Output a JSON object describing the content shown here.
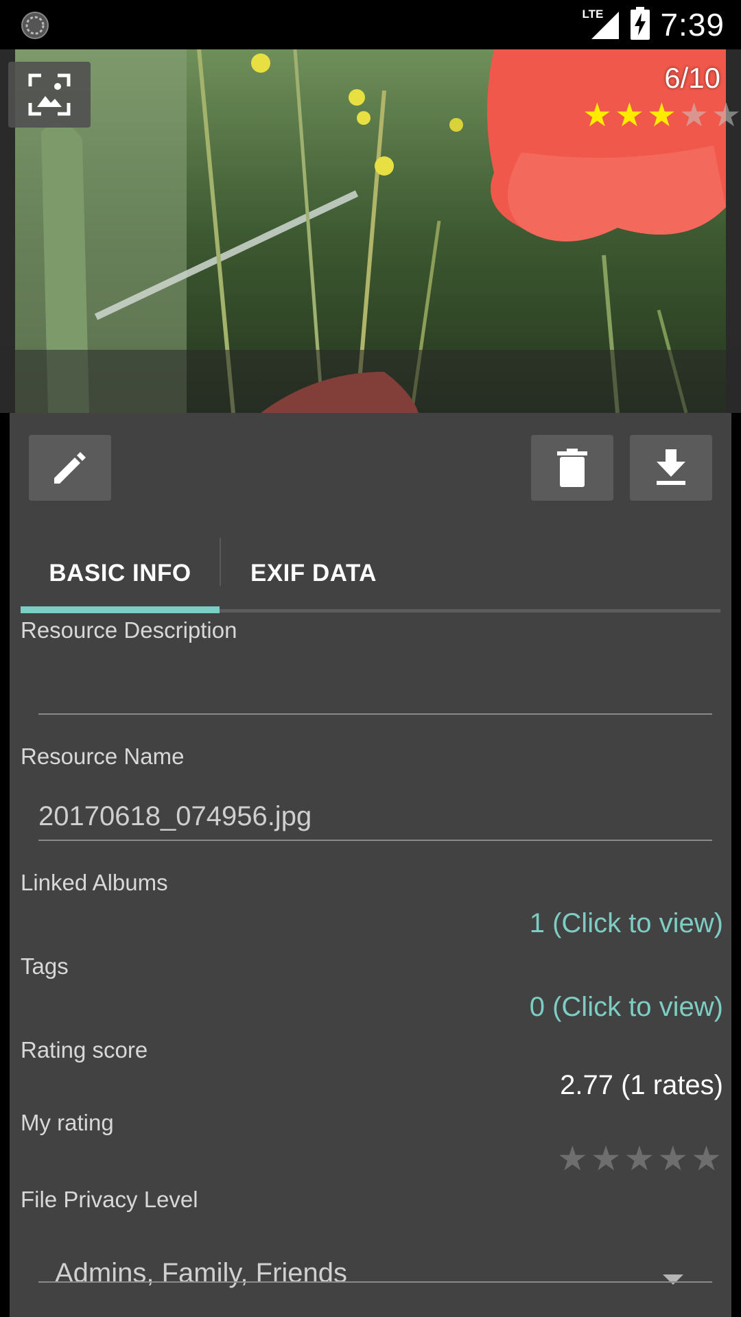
{
  "status_bar": {
    "network": "LTE",
    "time": "7:39"
  },
  "photo": {
    "counter": "6/10",
    "stars_filled": 3,
    "stars_total": 5
  },
  "toolbar": {
    "edit_icon": "pencil-icon",
    "delete_icon": "trash-icon",
    "download_icon": "download-icon"
  },
  "tabs": [
    {
      "label": "BASIC INFO",
      "selected": true
    },
    {
      "label": "EXIF DATA",
      "selected": false
    }
  ],
  "fields": {
    "description_label": "Resource Description",
    "description_value": "",
    "name_label": "Resource Name",
    "name_value": "20170618_074956.jpg",
    "albums_label": "Linked Albums",
    "albums_value": "1 (Click to view)",
    "tags_label": "Tags",
    "tags_value": "0 (Click to view)",
    "rating_label": "Rating score",
    "rating_value": "2.77 (1 rates)",
    "my_rating_label": "My rating",
    "my_rating_value": 0,
    "privacy_label": "File Privacy Level",
    "privacy_value": "Admins, Family, Friends"
  },
  "colors": {
    "accent": "#7ecdc4",
    "panel": "#424242",
    "star_yellow": "#ffeb00"
  }
}
